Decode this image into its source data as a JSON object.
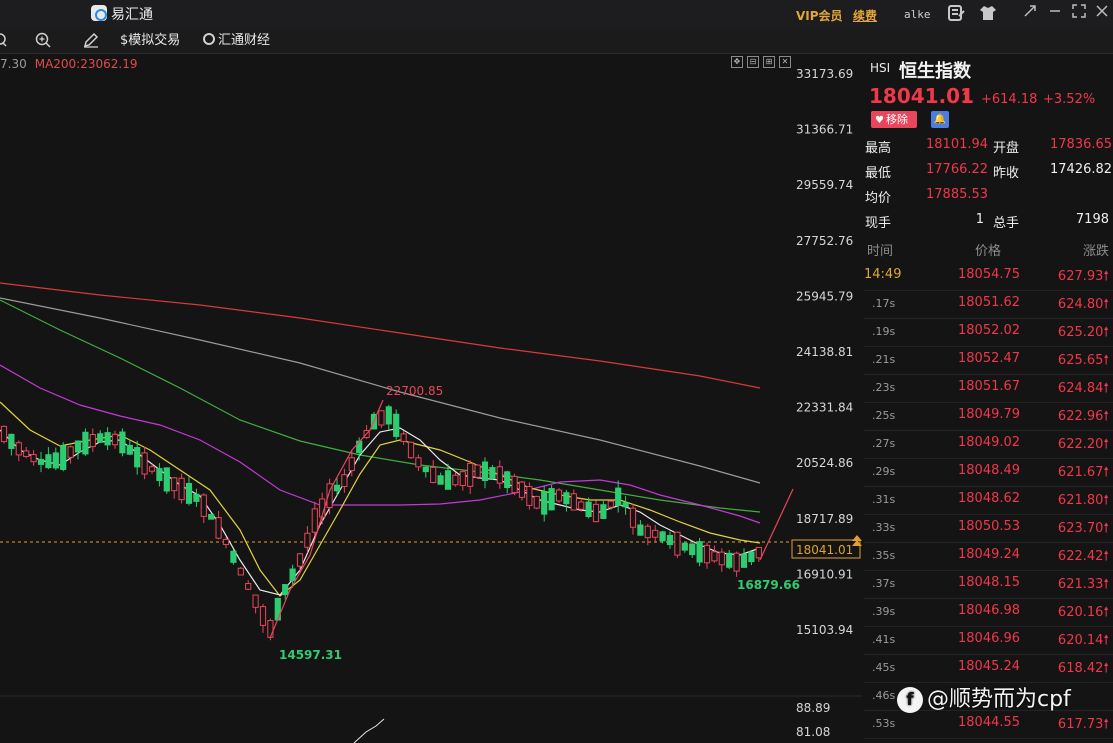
{
  "titlebar": {
    "app_name": "易汇通",
    "vip": "VIP会员",
    "renew": "续费",
    "username": "alke"
  },
  "toolbar": {
    "simulated_trading": "模拟交易",
    "finance": "汇通财经"
  },
  "chart": {
    "ma_prefix": "7.30",
    "ma200_label": "MA200:23062.19",
    "y_axis": [
      "33173.69",
      "31366.71",
      "29559.74",
      "27752.76",
      "25945.79",
      "24138.81",
      "22331.84",
      "20524.86",
      "18717.89",
      "16910.91",
      "15103.94"
    ],
    "sub_axis": [
      "88.89",
      "81.08"
    ],
    "current_price_tag": "18041.01",
    "high_label": "22700.85",
    "low_label": "14597.31",
    "recent_low_label": "16879.66",
    "colors": {
      "up": "#e8465a",
      "down": "#2ecc71",
      "ma200": "#d83a3a",
      "ma120": "#9a9a9a",
      "ma60": "#3fae3f",
      "ma30": "#c23ad6",
      "ma10": "#e3d23a",
      "ma5": "#e8e8e8"
    }
  },
  "quote": {
    "code": "HSI",
    "name": "恒生指数",
    "price": "18041.01",
    "change": "+614.18",
    "change_pct": "+3.52%",
    "remove_label": "移除",
    "high_label": "最高",
    "high": "18101.94",
    "open_label": "开盘",
    "open": "17836.65",
    "low_label": "最低",
    "low": "17766.22",
    "prev_close_label": "昨收",
    "prev_close": "17426.82",
    "avg_label": "均价",
    "avg": "17885.53",
    "cur_vol_label": "现手",
    "cur_vol": "1",
    "total_vol_label": "总手",
    "total_vol": "7198"
  },
  "ticks": {
    "headers": {
      "time": "时间",
      "price": "价格",
      "change": "涨跌"
    },
    "rows": [
      {
        "time": "14:49",
        "price": "18054.75",
        "change": "627.93"
      },
      {
        "time": ".17s",
        "price": "18051.62",
        "change": "624.80"
      },
      {
        "time": ".19s",
        "price": "18052.02",
        "change": "625.20"
      },
      {
        "time": ".21s",
        "price": "18052.47",
        "change": "625.65"
      },
      {
        "time": ".23s",
        "price": "18051.67",
        "change": "624.84"
      },
      {
        "time": ".25s",
        "price": "18049.79",
        "change": "622.96"
      },
      {
        "time": ".27s",
        "price": "18049.02",
        "change": "622.20"
      },
      {
        "time": ".29s",
        "price": "18048.49",
        "change": "621.67"
      },
      {
        "time": ".31s",
        "price": "18048.62",
        "change": "621.80"
      },
      {
        "time": ".33s",
        "price": "18050.53",
        "change": "623.70"
      },
      {
        "time": ".35s",
        "price": "18049.24",
        "change": "622.42"
      },
      {
        "time": ".37s",
        "price": "18048.15",
        "change": "621.33"
      },
      {
        "time": ".39s",
        "price": "18046.98",
        "change": "620.16"
      },
      {
        "time": ".41s",
        "price": "18046.96",
        "change": "620.14"
      },
      {
        "time": ".45s",
        "price": "18045.24",
        "change": "618.42"
      },
      {
        "time": ".46s",
        "price": "",
        "change": ""
      },
      {
        "time": ".53s",
        "price": "18044.55",
        "change": "617.73"
      }
    ]
  },
  "watermark": "@顺势而为cpf"
}
